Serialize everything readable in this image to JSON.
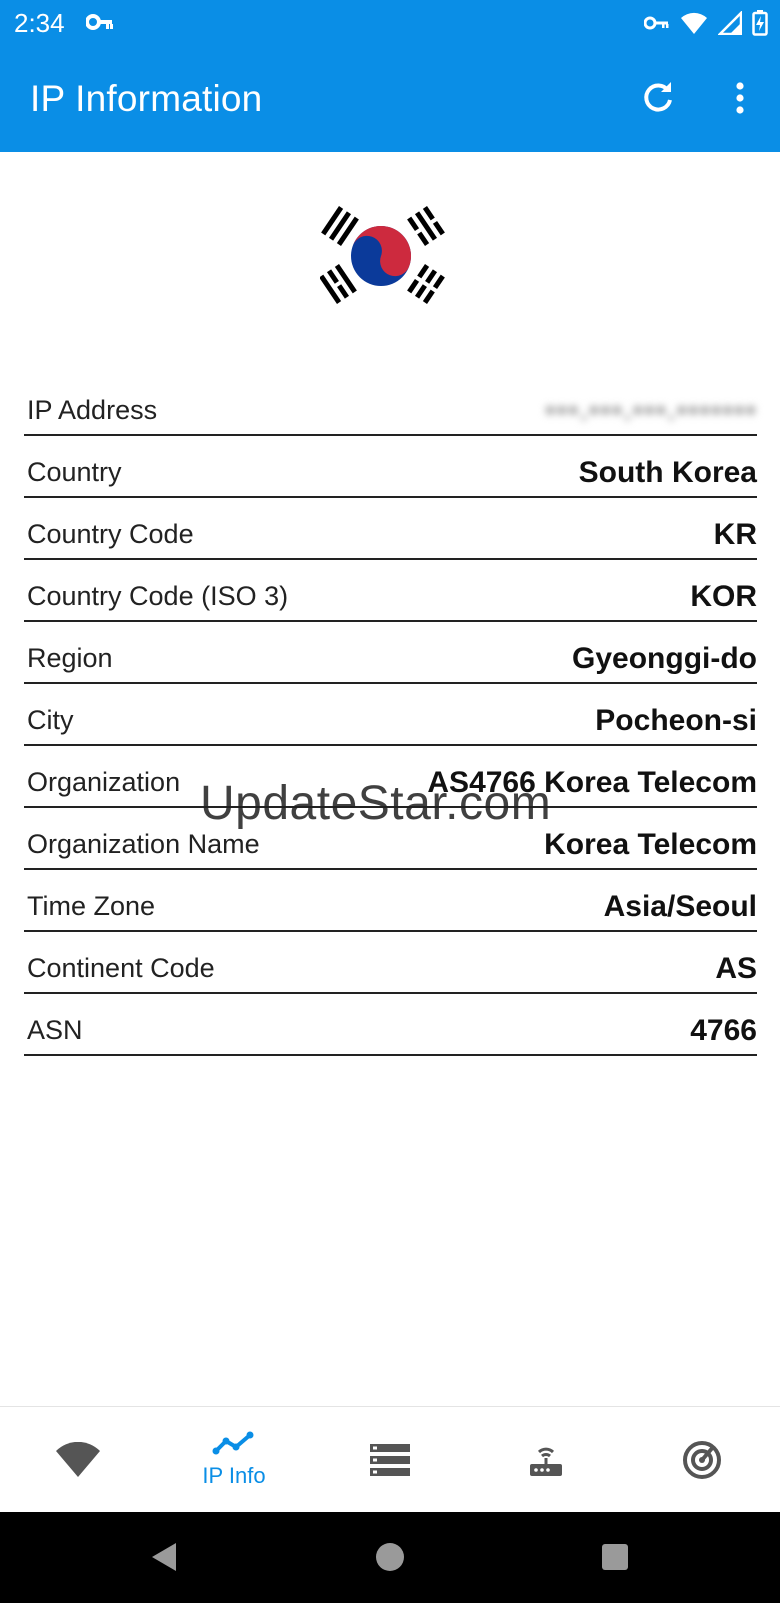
{
  "status_bar": {
    "time": "2:34"
  },
  "app_bar": {
    "title": "IP Information",
    "refresh_icon": "refresh-icon",
    "more_icon": "more-vert-icon"
  },
  "flag": {
    "icon": "south-korea-flag-icon"
  },
  "rows": [
    {
      "label": "IP Address",
      "value": "•••.•••.•••.•••••••"
    },
    {
      "label": "Country",
      "value": "South Korea"
    },
    {
      "label": "Country Code",
      "value": "KR"
    },
    {
      "label": "Country Code (ISO 3)",
      "value": "KOR"
    },
    {
      "label": "Region",
      "value": "Gyeonggi-do"
    },
    {
      "label": "City",
      "value": "Pocheon-si"
    },
    {
      "label": "Organization",
      "value": "AS4766 Korea Telecom"
    },
    {
      "label": "Organization Name",
      "value": "Korea Telecom"
    },
    {
      "label": "Time Zone",
      "value": "Asia/Seoul"
    },
    {
      "label": "Continent Code",
      "value": "AS"
    },
    {
      "label": "ASN",
      "value": "4766"
    }
  ],
  "watermark": "UpdateStar.com",
  "bottom_nav": [
    {
      "icon": "wifi-icon",
      "label": ""
    },
    {
      "icon": "ip-info-chart-icon",
      "label": "IP Info"
    },
    {
      "icon": "server-list-icon",
      "label": ""
    },
    {
      "icon": "router-icon",
      "label": ""
    },
    {
      "icon": "radar-icon",
      "label": ""
    }
  ],
  "colors": {
    "primary": "#0a8ee6",
    "inactive_icon": "#555555"
  }
}
